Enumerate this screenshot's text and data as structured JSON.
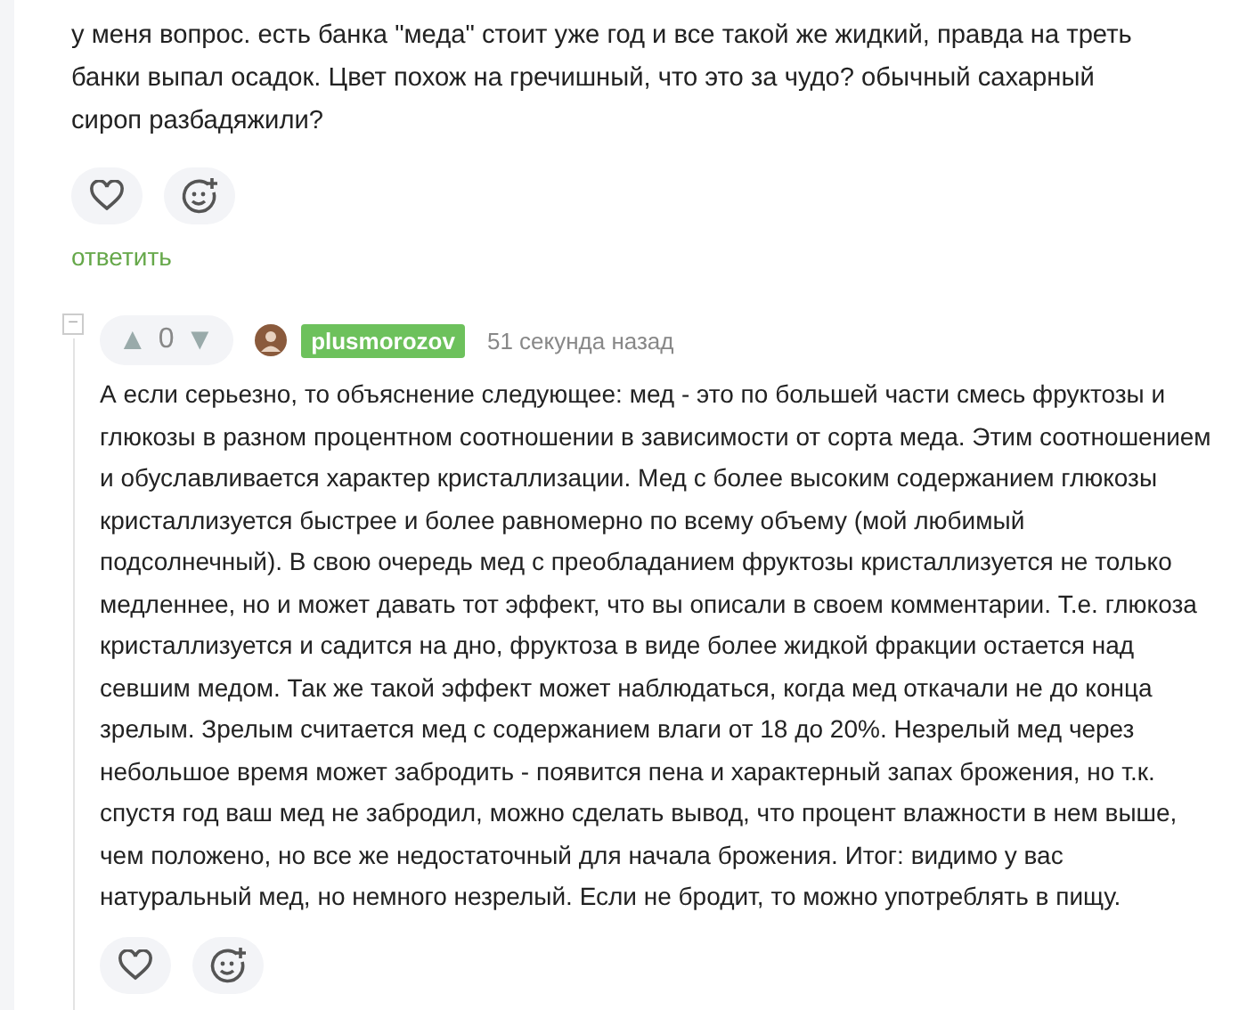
{
  "question": {
    "text": "у меня вопрос. есть банка \"меда\" стоит уже год и все такой же жидкий, правда на треть банки выпал осадок. Цвет похож на гречишный, что это за чудо? обычный сахарный сироп разбадяжили?",
    "reply_link": "ответить"
  },
  "reply": {
    "collapse": "−",
    "votes": {
      "up": "▲",
      "count": "0",
      "down": "▼"
    },
    "username": "plusmorozov",
    "time": "51 секунда назад",
    "text": "А если серьезно, то объяснение следующее: мед - это по большей части смесь фруктозы и глюкозы в разном процентном соотношении в зависимости от сорта меда. Этим соотношением и обуславливается характер кристаллизации. Мед с более высоким содержанием глюкозы кристаллизуется быстрее и более равномерно по всему объему (мой любимый подсолнечный). В свою очередь мед с преобладанием фруктозы кристаллизуется не только медленнее, но и может давать тот эффект, что вы описали в своем комментарии. Т.е. глюкоза кристаллизуется и садится на дно, фруктоза в виде более жидкой фракции остается над севшим медом. Так же такой эффект может наблюдаться, когда мед откачали не до конца зрелым. Зрелым считается мед с содержанием влаги от 18 до 20%. Незрелый мед через небольшое время может забродить - появится пена и характерный запах брожения, но т.к. спустя год ваш мед не забродил, можно сделать вывод, что процент влажности в нем выше, чем положено, но все же недостаточный для начала брожения. Итог: видимо у вас натуральный мед, но немного незрелый. Если не бродит, то можно употреблять в пищу."
  }
}
